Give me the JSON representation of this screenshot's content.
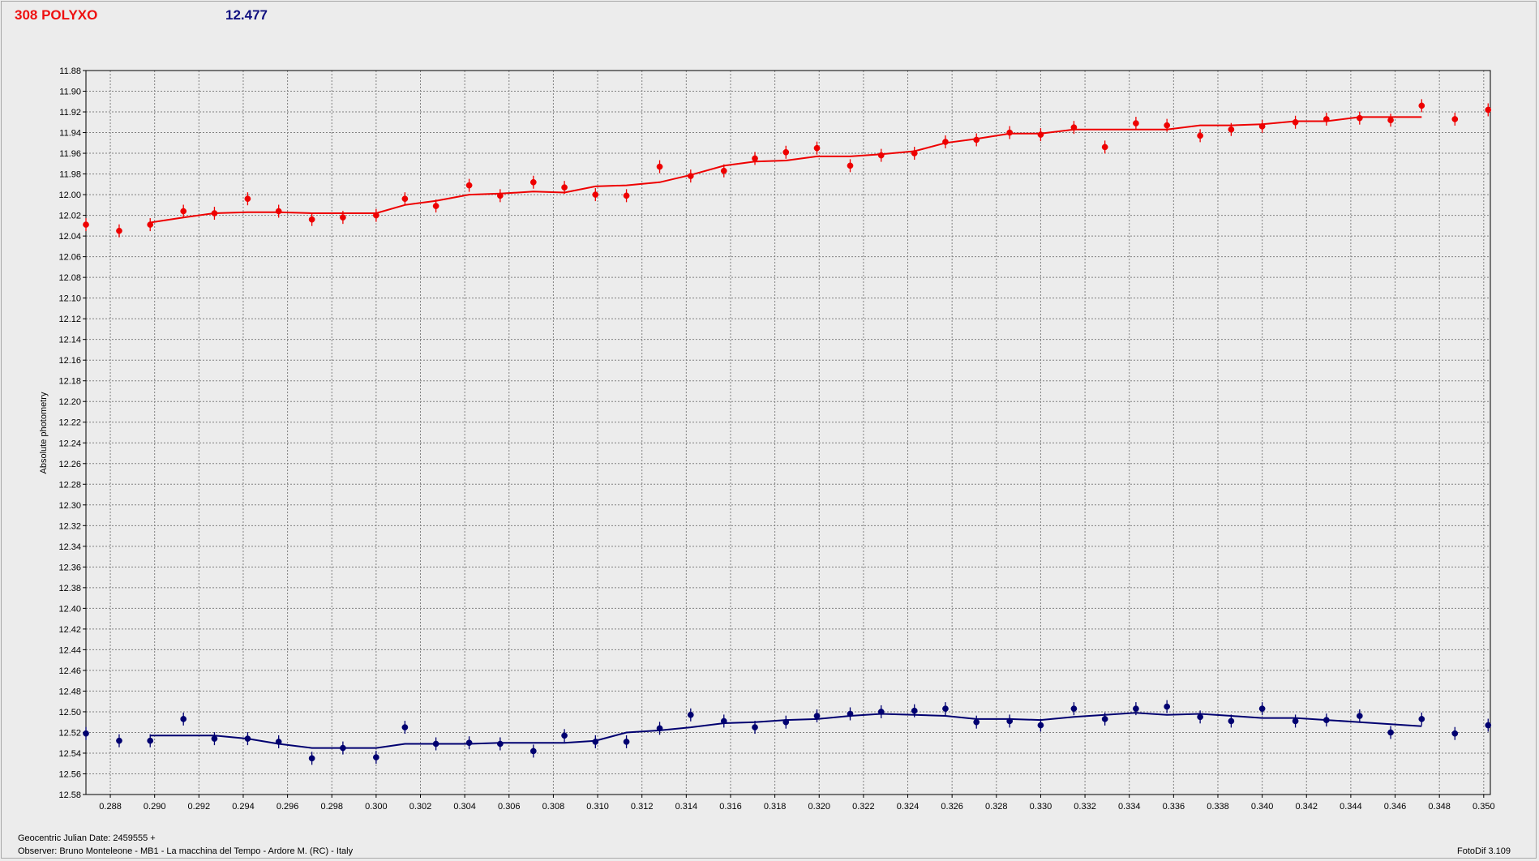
{
  "header": {
    "object_name": "308 POLYXO",
    "mean_value": "12.477"
  },
  "footer": {
    "date_line": "Geocentric Julian Date: 2459555 +",
    "observer_line": "Observer: Bruno Monteleone - MB1 - La macchina del Tempo - Ardore M. (RC) - Italy",
    "software": "FotoDif 3.109"
  },
  "colors": {
    "series_top": "#ee0000",
    "series_bottom": "#000070",
    "grid": "#808080",
    "plot_bg": "#ececec"
  },
  "chart_data": {
    "type": "scatter",
    "title": "",
    "ylabel": "Absolute photometry",
    "xlabel": "",
    "xlim": [
      0.2869,
      0.3503
    ],
    "ylim": [
      11.88,
      12.58
    ],
    "y_inverted": true,
    "grid": true,
    "x_ticks": [
      "0.288",
      "0.290",
      "0.292",
      "0.294",
      "0.296",
      "0.298",
      "0.300",
      "0.302",
      "0.304",
      "0.306",
      "0.308",
      "0.310",
      "0.312",
      "0.314",
      "0.316",
      "0.318",
      "0.320",
      "0.322",
      "0.324",
      "0.326",
      "0.328",
      "0.330",
      "0.332",
      "0.334",
      "0.336",
      "0.338",
      "0.340",
      "0.342",
      "0.344",
      "0.346",
      "0.348",
      "0.350"
    ],
    "y_ticks": [
      "11.88",
      "11.90",
      "11.92",
      "11.94",
      "11.96",
      "11.98",
      "12.00",
      "12.02",
      "12.04",
      "12.06",
      "12.08",
      "12.10",
      "12.12",
      "12.14",
      "12.16",
      "12.18",
      "12.20",
      "12.22",
      "12.24",
      "12.26",
      "12.28",
      "12.30",
      "12.32",
      "12.34",
      "12.36",
      "12.38",
      "12.40",
      "12.42",
      "12.44",
      "12.46",
      "12.48",
      "12.50",
      "12.52",
      "12.54",
      "12.56",
      "12.58"
    ],
    "series": [
      {
        "x": [
          0.2869,
          0.2884,
          0.2898,
          0.2913,
          0.2927,
          0.2942,
          0.2956,
          0.2971,
          0.2985,
          0.3,
          0.3013,
          0.3027,
          0.3042,
          0.3056,
          0.3071,
          0.3085,
          0.3099,
          0.3113,
          0.3128,
          0.3142,
          0.3157,
          0.3171,
          0.3185,
          0.3199,
          0.3214,
          0.3228,
          0.3243,
          0.3257,
          0.3271,
          0.3286,
          0.33,
          0.3315,
          0.3329,
          0.3343,
          0.3357,
          0.3372,
          0.3386,
          0.34,
          0.3415,
          0.3429,
          0.3444,
          0.3458,
          0.3472,
          0.3487,
          0.3502
        ],
        "y": [
          12.029,
          12.035,
          12.029,
          12.016,
          12.018,
          12.004,
          12.016,
          12.024,
          12.022,
          12.02,
          12.004,
          12.011,
          11.991,
          12.001,
          11.988,
          11.993,
          12.0,
          12.001,
          11.973,
          11.982,
          11.977,
          11.965,
          11.959,
          11.955,
          11.972,
          11.962,
          11.96,
          11.949,
          11.947,
          11.94,
          11.942,
          11.935,
          11.954,
          11.931,
          11.933,
          11.943,
          11.937,
          11.934,
          11.93,
          11.927,
          11.926,
          11.928,
          11.914,
          11.927,
          11.918
        ],
        "fit_x": [
          0.2898,
          0.2913,
          0.2927,
          0.2942,
          0.2956,
          0.2971,
          0.2985,
          0.3,
          0.3013,
          0.3027,
          0.3042,
          0.3056,
          0.3071,
          0.3085,
          0.3099,
          0.3113,
          0.3128,
          0.3142,
          0.3157,
          0.3171,
          0.3185,
          0.3199,
          0.3214,
          0.3228,
          0.3243,
          0.3257,
          0.3271,
          0.3286,
          0.33,
          0.3315,
          0.3329,
          0.3343,
          0.3357,
          0.3372,
          0.3386,
          0.34,
          0.3415,
          0.3429,
          0.3444,
          0.3458,
          0.3472
        ],
        "fit_y": [
          12.027,
          12.022,
          12.018,
          12.017,
          12.017,
          12.018,
          12.018,
          12.018,
          12.01,
          12.006,
          12.0,
          11.999,
          11.997,
          11.998,
          11.992,
          11.991,
          11.988,
          11.981,
          11.972,
          11.968,
          11.967,
          11.963,
          11.963,
          11.961,
          11.958,
          11.95,
          11.946,
          11.941,
          11.941,
          11.937,
          11.937,
          11.937,
          11.937,
          11.933,
          11.933,
          11.932,
          11.929,
          11.929,
          11.925,
          11.925,
          11.925
        ]
      },
      {
        "x": [
          0.2869,
          0.2884,
          0.2898,
          0.2913,
          0.2927,
          0.2942,
          0.2956,
          0.2971,
          0.2985,
          0.3,
          0.3013,
          0.3027,
          0.3042,
          0.3056,
          0.3071,
          0.3085,
          0.3099,
          0.3113,
          0.3128,
          0.3142,
          0.3157,
          0.3171,
          0.3185,
          0.3199,
          0.3214,
          0.3228,
          0.3243,
          0.3257,
          0.3271,
          0.3286,
          0.33,
          0.3315,
          0.3329,
          0.3343,
          0.3357,
          0.3372,
          0.3386,
          0.34,
          0.3415,
          0.3429,
          0.3444,
          0.3458,
          0.3472,
          0.3487,
          0.3502
        ],
        "y": [
          12.521,
          12.528,
          12.528,
          12.507,
          12.526,
          12.526,
          12.529,
          12.545,
          12.535,
          12.544,
          12.515,
          12.531,
          12.53,
          12.531,
          12.538,
          12.523,
          12.529,
          12.529,
          12.516,
          12.503,
          12.509,
          12.515,
          12.51,
          12.504,
          12.502,
          12.5,
          12.499,
          12.497,
          12.51,
          12.509,
          12.513,
          12.497,
          12.507,
          12.497,
          12.495,
          12.505,
          12.509,
          12.497,
          12.509,
          12.508,
          12.504,
          12.52,
          12.507,
          12.521,
          12.513
        ],
        "fit_x": [
          0.2898,
          0.2913,
          0.2927,
          0.2942,
          0.2956,
          0.2971,
          0.2985,
          0.3,
          0.3013,
          0.3027,
          0.3042,
          0.3056,
          0.3071,
          0.3085,
          0.3099,
          0.3113,
          0.3128,
          0.3142,
          0.3157,
          0.3171,
          0.3185,
          0.3199,
          0.3214,
          0.3228,
          0.3243,
          0.3257,
          0.3271,
          0.3286,
          0.33,
          0.3315,
          0.3329,
          0.3343,
          0.3357,
          0.3372,
          0.3386,
          0.34,
          0.3415,
          0.3429,
          0.3444,
          0.3458,
          0.3472
        ],
        "fit_y": [
          12.523,
          12.523,
          12.523,
          12.526,
          12.531,
          12.535,
          12.535,
          12.535,
          12.531,
          12.531,
          12.531,
          12.53,
          12.53,
          12.53,
          12.528,
          12.52,
          12.518,
          12.515,
          12.511,
          12.51,
          12.508,
          12.507,
          12.504,
          12.502,
          12.503,
          12.504,
          12.507,
          12.507,
          12.508,
          12.505,
          12.503,
          12.501,
          12.503,
          12.502,
          12.504,
          12.506,
          12.506,
          12.508,
          12.51,
          12.512,
          12.514
        ]
      }
    ]
  }
}
